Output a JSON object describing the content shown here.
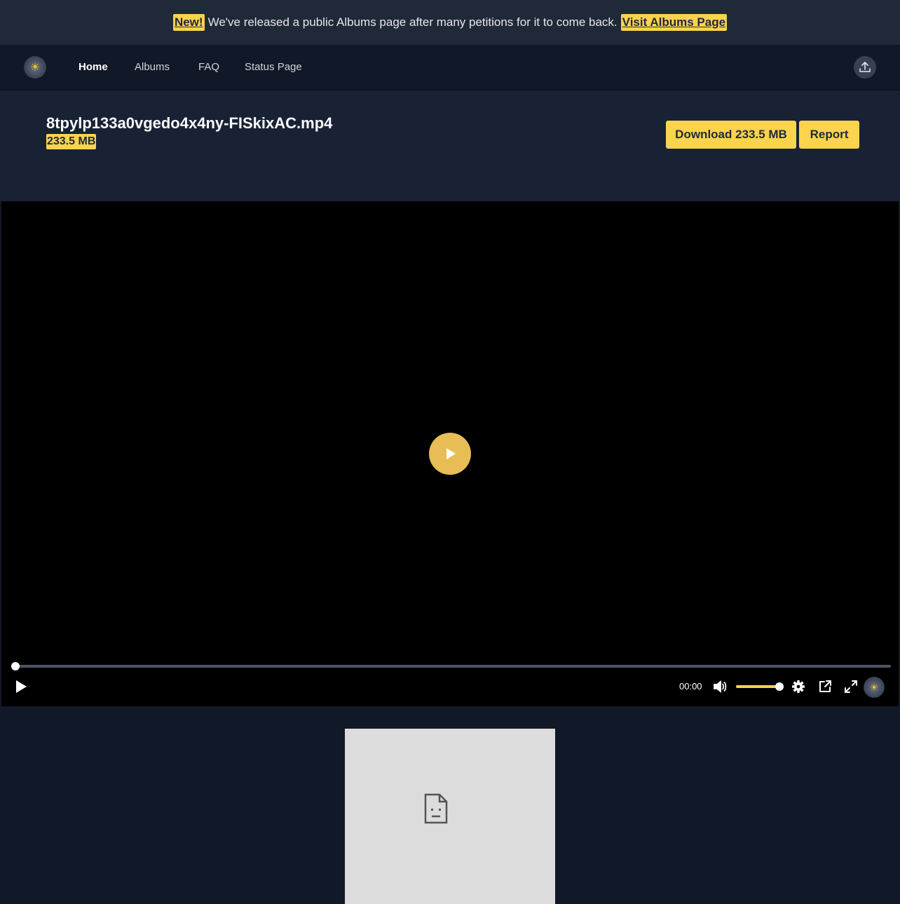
{
  "announcement": {
    "badge": "New!",
    "message": "We've released a public Albums page after many petitions for it to come back.",
    "link": "Visit Albums Page"
  },
  "nav": {
    "logo_icon": "sun-logo-icon",
    "items": [
      {
        "label": "Home",
        "active": true
      },
      {
        "label": "Albums",
        "active": false
      },
      {
        "label": "FAQ",
        "active": false
      },
      {
        "label": "Status Page",
        "active": false
      }
    ],
    "upload_icon": "upload-icon"
  },
  "file": {
    "name": "8tpylp133a0vgedo4x4ny-FISkixAC.mp4",
    "size": "233.5 MB",
    "download_label": "Download 233.5 MB",
    "report_label": "Report"
  },
  "player": {
    "current_time": "00:00",
    "progress": 0,
    "volume": 1.0,
    "icons": [
      "play-icon",
      "volume-icon",
      "settings-icon",
      "pip-icon",
      "fullscreen-icon"
    ]
  },
  "colors": {
    "accent": "#fcd34d",
    "background": "#111827",
    "header_bg": "#182234",
    "banner_bg": "#1f2937"
  }
}
